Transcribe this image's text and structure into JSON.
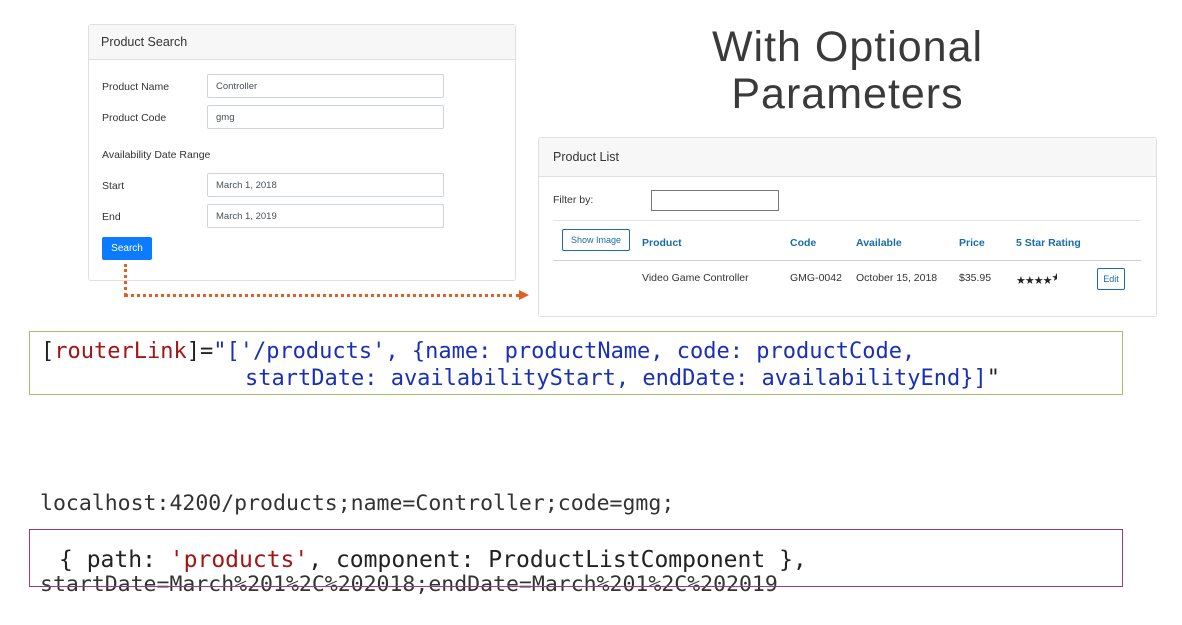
{
  "slide": {
    "title_line1": "With Optional",
    "title_line2": "Parameters"
  },
  "search_card": {
    "header": "Product Search",
    "product_name_label": "Product Name",
    "product_name_value": "Controller",
    "product_code_label": "Product Code",
    "product_code_value": "gmg",
    "date_range_label": "Availability Date Range",
    "start_label": "Start",
    "start_value": "March 1, 2018",
    "end_label": "End",
    "end_value": "March 1, 2019",
    "search_button": "Search"
  },
  "list_card": {
    "header": "Product List",
    "filter_label": "Filter by:",
    "filter_value": "",
    "show_image_button": "Show Image",
    "columns": [
      "Product",
      "Code",
      "Available",
      "Price",
      "5 Star Rating"
    ],
    "rows": [
      {
        "product": "Video Game Controller",
        "code": "GMG-0042",
        "available": "October 15, 2018",
        "price": "$35.95",
        "rating": 4.8,
        "edit_label": "Edit"
      }
    ]
  },
  "code_router_link": {
    "line1_attr": "[routerLink]",
    "line1_mid": "=\"[",
    "line1_value": "'/products', {name: productName, code: productCode,",
    "line2_value": "startDate: availabilityStart, endDate: availabilityEnd}]",
    "line2_end": "\""
  },
  "url": {
    "line1": "localhost:4200/products;name=Controller;code=gmg;",
    "line2": "startDate=March%201%2C%202018;endDate=March%201%2C%202019"
  },
  "route_config": {
    "open": "{ path: ",
    "path_value": "'products'",
    "rest": ", component: ProductListComponent },"
  },
  "colors": {
    "primary_button": "#0d7bff",
    "link_blue": "#1b6ba8",
    "connector": "#e15e24",
    "code_red": "#a31515",
    "code_blue": "#1a2fb8",
    "box1_border": "#a8bf70",
    "box2_border": "#9a3d7c"
  }
}
